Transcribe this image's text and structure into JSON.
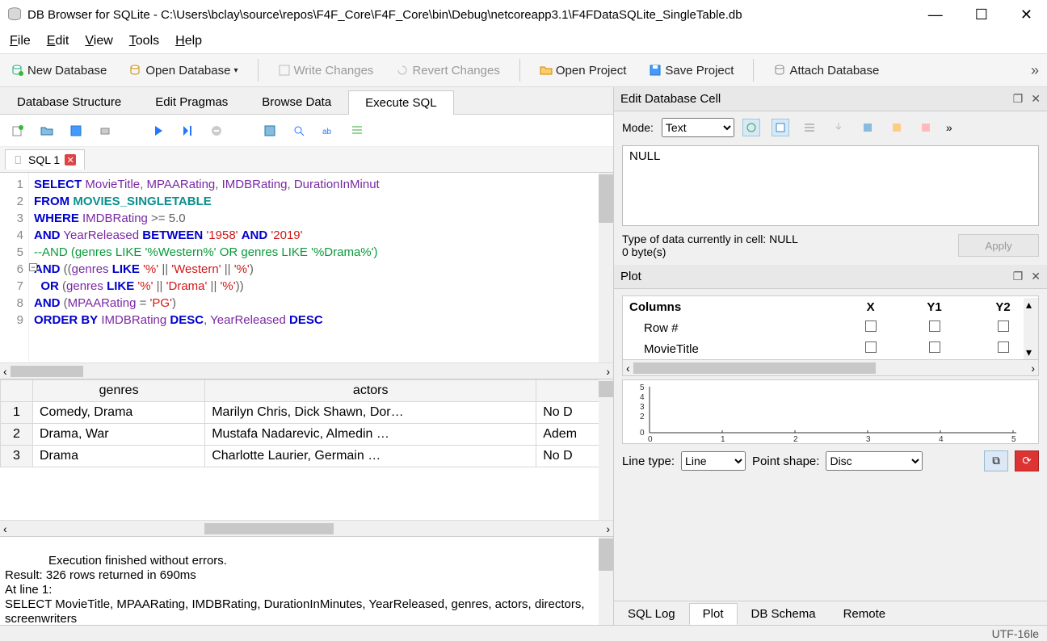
{
  "window": {
    "title": "DB Browser for SQLite - C:\\Users\\bclay\\source\\repos\\F4F_Core\\F4F_Core\\bin\\Debug\\netcoreapp3.1\\F4FDataSQLite_SingleTable.db"
  },
  "menu": [
    "File",
    "Edit",
    "View",
    "Tools",
    "Help"
  ],
  "toolbar": {
    "new_db": "New Database",
    "open_db": "Open Database",
    "write": "Write Changes",
    "revert": "Revert Changes",
    "open_proj": "Open Project",
    "save_proj": "Save Project",
    "attach": "Attach Database"
  },
  "main_tabs": [
    "Database Structure",
    "Edit Pragmas",
    "Browse Data",
    "Execute SQL"
  ],
  "main_tab_active": "Execute SQL",
  "sql_tab": {
    "label": "SQL 1"
  },
  "sql_lines": [
    "SELECT MovieTitle, MPAARating, IMDBRating, DurationInMinut",
    "FROM MOVIES_SINGLETABLE",
    "WHERE IMDBRating >= 5.0",
    "AND YearReleased BETWEEN '1958' AND '2019'",
    "--AND (genres LIKE '%Western%' OR genres LIKE '%Drama%')",
    "AND ((genres LIKE '%' || 'Western' || '%')",
    "  OR (genres LIKE '%' || 'Drama' || '%'))",
    "AND (MPAARating = 'PG')",
    "ORDER BY IMDBRating DESC, YearReleased DESC"
  ],
  "result_headers": [
    "",
    "genres",
    "actors",
    ""
  ],
  "result_rows": [
    {
      "n": "1",
      "genres": "Comedy, Drama",
      "actors": "Marilyn Chris, Dick Shawn, Dor…",
      "c3": "No D"
    },
    {
      "n": "2",
      "genres": "Drama, War",
      "actors": "Mustafa Nadarevic, Almedin …",
      "c3": "Adem"
    },
    {
      "n": "3",
      "genres": "Drama",
      "actors": "Charlotte Laurier, Germain …",
      "c3": "No D"
    }
  ],
  "log_text": "Execution finished without errors.\nResult: 326 rows returned in 690ms\nAt line 1:\nSELECT MovieTitle, MPAARating, IMDBRating, DurationInMinutes, YearReleased, genres, actors, directors, screenwriters",
  "cell_panel": {
    "header": "Edit Database Cell",
    "mode_label": "Mode:",
    "mode_value": "Text",
    "content": "NULL",
    "type_line": "Type of data currently in cell: NULL",
    "size_line": "0 byte(s)",
    "apply": "Apply"
  },
  "plot_panel": {
    "header": "Plot",
    "cols_header": [
      "Columns",
      "X",
      "Y1",
      "Y2"
    ],
    "col_rows": [
      "Row #",
      "MovieTitle"
    ],
    "line_type_label": "Line type:",
    "line_type_value": "Line",
    "point_shape_label": "Point shape:",
    "point_shape_value": "Disc"
  },
  "chart_data": {
    "type": "line",
    "x": [
      0,
      1,
      2,
      3,
      4,
      5
    ],
    "values": [],
    "xlim": [
      0,
      5
    ],
    "ylim": [
      0,
      5
    ],
    "yticks": [
      0,
      2,
      3,
      4,
      5
    ],
    "xticks": [
      0,
      1,
      2,
      3,
      4,
      5
    ]
  },
  "bottom_tabs": [
    "SQL Log",
    "Plot",
    "DB Schema",
    "Remote"
  ],
  "bottom_tab_active": "Plot",
  "status": {
    "encoding": "UTF-16le"
  }
}
